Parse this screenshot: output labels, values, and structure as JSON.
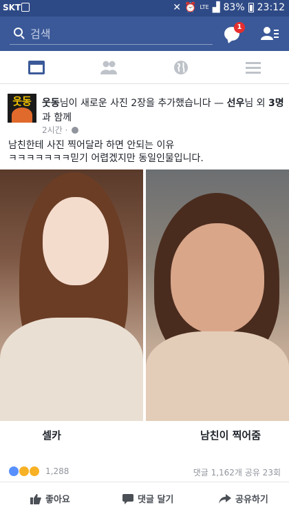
{
  "status_bar": {
    "carrier": "SKT",
    "network": "LTE",
    "battery": "83%",
    "time": "23:12"
  },
  "search": {
    "placeholder": "검색",
    "messenger_badge": "1"
  },
  "tabs": [
    "news-feed",
    "friends",
    "globe",
    "menu"
  ],
  "post": {
    "page_thumb_text": "웃동",
    "author": "웃동",
    "action_text": "님이 새로운 사진 2장을 추가했습니다 — ",
    "tagged": "선우",
    "tagged_suffix": "님 외 ",
    "others": "3명",
    "others_suffix": "과 함께",
    "time": "2시간 · ",
    "caption": "남친한테 사진 찍어달라 하면 안되는 이유\nㅋㅋㅋㅋㅋㅋㅋ믿기 어렵겠지만 동일인물입니다.",
    "photo_labels": [
      "셀카",
      "남친이 찍어줌"
    ]
  },
  "engagement": {
    "reaction_count": "1,288",
    "stats": "댓글 1,162개 공유 23회"
  },
  "actions": {
    "like": "좋아요",
    "comment": "댓글 달기",
    "share": "공유하기"
  },
  "colors": {
    "brand": "#3b5998",
    "status_bar": "#2e4a86",
    "badge": "#e62e2e",
    "text_muted": "#90949c"
  }
}
